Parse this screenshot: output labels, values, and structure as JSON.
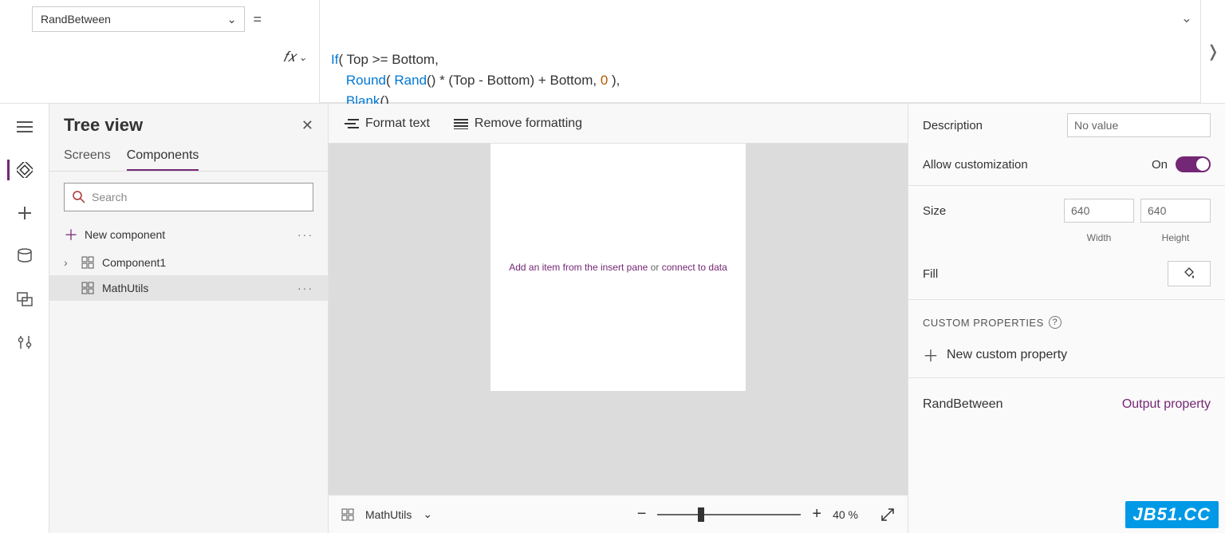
{
  "formulaBar": {
    "property": "RandBetween",
    "formula_html": "<span class='kw'>If</span>( Top &gt;= Bottom,\n    <span class='fn'>Round</span>( <span class='fn'>Rand</span>() * (Top - Bottom) + Bottom, <span class='num'>0</span> ),\n    <span class='fn'>Blank</span>()\n)"
  },
  "formatBar": {
    "formatText": "Format text",
    "removeFormatting": "Remove formatting"
  },
  "treeView": {
    "title": "Tree view",
    "tabs": {
      "screens": "Screens",
      "components": "Components"
    },
    "searchPlaceholder": "Search",
    "newComponent": "New component",
    "items": [
      {
        "label": "Component1",
        "selected": false,
        "expandable": true
      },
      {
        "label": "MathUtils",
        "selected": true,
        "expandable": false
      }
    ]
  },
  "canvas": {
    "hint_pre": "Add an item from the insert pane",
    "hint_or": " or ",
    "hint_post": "connect to data",
    "selectedName": "MathUtils",
    "zoom": "40  %"
  },
  "props": {
    "descriptionLabel": "Description",
    "descriptionValue": "No value",
    "allowCustomizationLabel": "Allow customization",
    "allowCustomizationValue": "On",
    "sizeLabel": "Size",
    "width": "640",
    "height": "640",
    "widthLabel": "Width",
    "heightLabel": "Height",
    "fillLabel": "Fill",
    "customHeader": "CUSTOM PROPERTIES",
    "newCustomProp": "New custom property",
    "customProps": [
      {
        "name": "RandBetween",
        "type": "Output property"
      }
    ]
  },
  "watermark": "JB51.CC"
}
